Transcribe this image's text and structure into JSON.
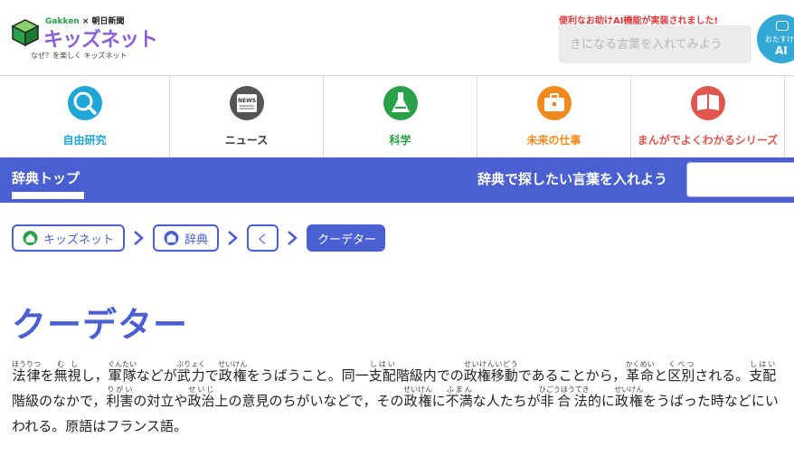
{
  "header": {
    "brand_gakken": "Gakken",
    "brand_x": "×",
    "brand_asahi": "朝日新聞",
    "logo_text": "キッズネット",
    "tagline": "なぜ？を楽しく キッズネット",
    "ai_note": "便利なお助けAI機能が実装されました!",
    "search_placeholder": "きになる言葉を入れてみよう",
    "ai_button_small": "おたすけ",
    "ai_button_large": "AI"
  },
  "categories": [
    {
      "label": "自由研究",
      "color": "#1fa6d6",
      "icon": "magnifier-icon"
    },
    {
      "label": "ニュース",
      "color": "#333333",
      "icon": "newspaper-icon"
    },
    {
      "label": "科学",
      "color": "#2aa148",
      "icon": "flask-icon"
    },
    {
      "label": "未来の仕事",
      "color": "#f08a1c",
      "icon": "briefcase-icon"
    },
    {
      "label": "まんがでよくわかるシリーズ",
      "color": "#e0574f",
      "icon": "book-icon"
    }
  ],
  "dictbar": {
    "top_label": "辞典トップ",
    "search_prompt": "辞典で探したい言葉を入れよう"
  },
  "breadcrumb": {
    "home": "キッズネット",
    "dict": "辞典",
    "letter": "く",
    "current": "クーデター"
  },
  "entry": {
    "title": "クーデター"
  },
  "colors": {
    "accent": "#4a5fd2",
    "alert": "#e23b3b",
    "ai": "#34a9d8"
  }
}
